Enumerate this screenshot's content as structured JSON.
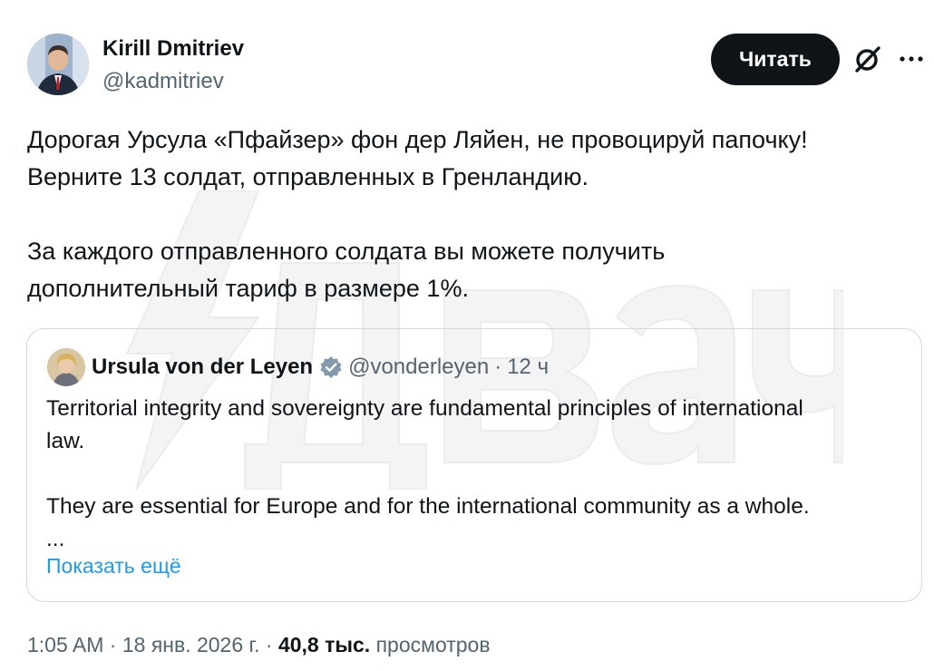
{
  "tweet": {
    "author": {
      "name": "Kirill Dmitriev",
      "handle": "@kadmitriev"
    },
    "read_button": "Читать",
    "text_lines": [
      "Дорогая Урсула «Пфайзер» фон дер Ляйен, не провоцируй папочку!",
      "Верните 13 солдат, отправленных в Гренландию.",
      "За каждого отправленного солдата вы можете получить",
      "дополнительный тариф в размере 1%."
    ],
    "quote": {
      "name": "Ursula von der Leyen",
      "handle": "@vonderleyen",
      "separator": "·",
      "time": "12 ч",
      "lines": [
        "Territorial integrity and sovereignty are fundamental principles of international",
        "law.",
        "They are essential for Europe and for the international community as a whole.",
        "..."
      ],
      "show_more": "Показать ещё"
    },
    "meta": {
      "time": "1:05 AM",
      "sep1": "·",
      "date": "18 янв. 2026 г.",
      "sep2": "·",
      "views_count": "40,8 тыс.",
      "views_label": "просмотров"
    }
  },
  "watermark_text": "Двач",
  "icons": {
    "grok": "grok-icon",
    "more": "more-icon",
    "verified": "verified-icon"
  },
  "colors": {
    "accent": "#1d9bf0",
    "text": "#0f1419",
    "secondary": "#536471",
    "border": "#cfd9de",
    "button_bg": "#0f1419"
  }
}
